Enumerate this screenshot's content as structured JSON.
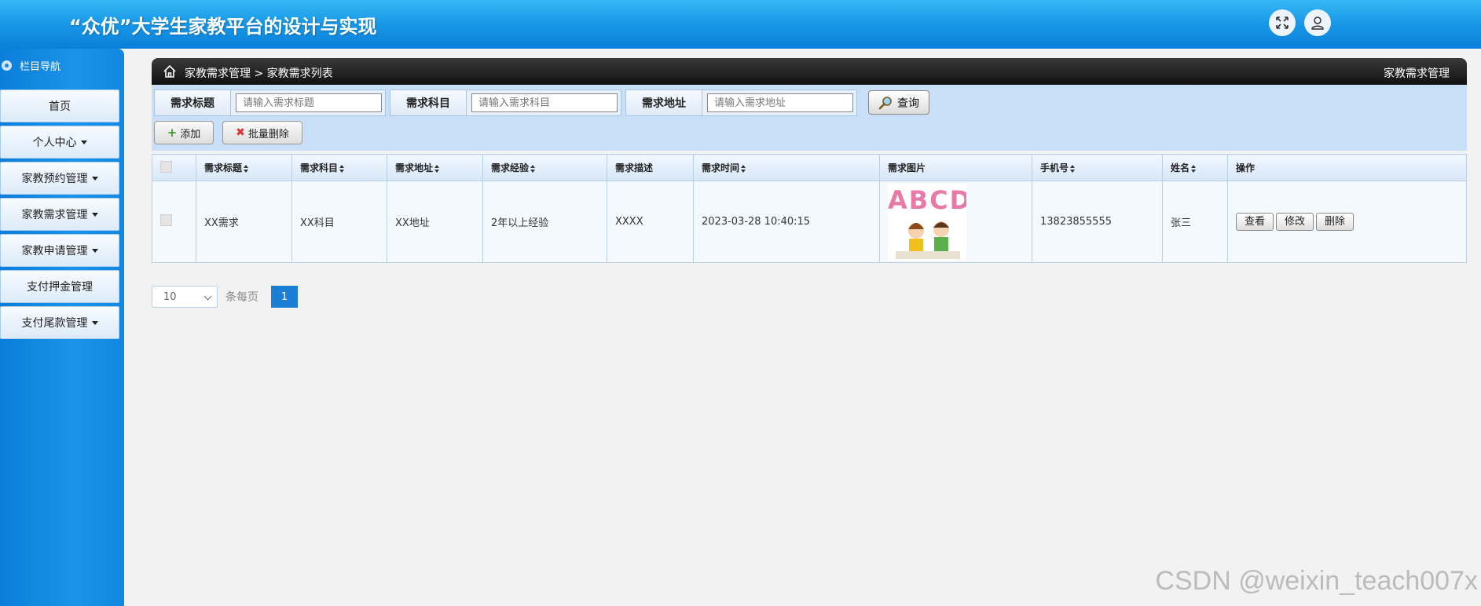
{
  "app": {
    "title": "“众优”大学生家教平台的设计与实现"
  },
  "sidebar": {
    "nav_title": "栏目导航",
    "items": [
      {
        "label": "首页",
        "dropdown": false
      },
      {
        "label": "个人中心",
        "dropdown": true
      },
      {
        "label": "家教预约管理",
        "dropdown": true
      },
      {
        "label": "家教需求管理",
        "dropdown": true
      },
      {
        "label": "家教申请管理",
        "dropdown": true
      },
      {
        "label": "支付押金管理",
        "dropdown": false
      },
      {
        "label": "支付尾款管理",
        "dropdown": true
      }
    ]
  },
  "breadcrumb": {
    "path": "家教需求管理 > 家教需求列表",
    "right": "家教需求管理"
  },
  "filters": [
    {
      "label": "需求标题",
      "placeholder": "请输入需求标题"
    },
    {
      "label": "需求科目",
      "placeholder": "请输入需求科目"
    },
    {
      "label": "需求地址",
      "placeholder": "请输入需求地址"
    }
  ],
  "buttons": {
    "query": "查询",
    "add": "添加",
    "batch_delete": "批量删除"
  },
  "table": {
    "columns": [
      "需求标题",
      "需求科目",
      "需求地址",
      "需求经验",
      "需求描述",
      "需求时间",
      "需求图片",
      "手机号",
      "姓名",
      "操作"
    ],
    "sortable": [
      true,
      true,
      true,
      true,
      false,
      true,
      false,
      true,
      true,
      false
    ],
    "rows": [
      {
        "title": "XX需求",
        "subject": "XX科目",
        "address": "XX地址",
        "experience": "2年以上经验",
        "description": "XXXX",
        "time": "2023-03-28 10:40:15",
        "image_letters": "ABCD",
        "phone": "13823855555",
        "name": "张三"
      }
    ],
    "row_actions": [
      "查看",
      "修改",
      "删除"
    ]
  },
  "pagination": {
    "page_size": "10",
    "per_page_label": "条每页",
    "current_page": "1"
  },
  "watermark": "CSDN @weixin_teach007x",
  "colors": {
    "header": "#1a9ae8",
    "sidebar": "#1187e0",
    "accent": "#1a7fd4"
  }
}
